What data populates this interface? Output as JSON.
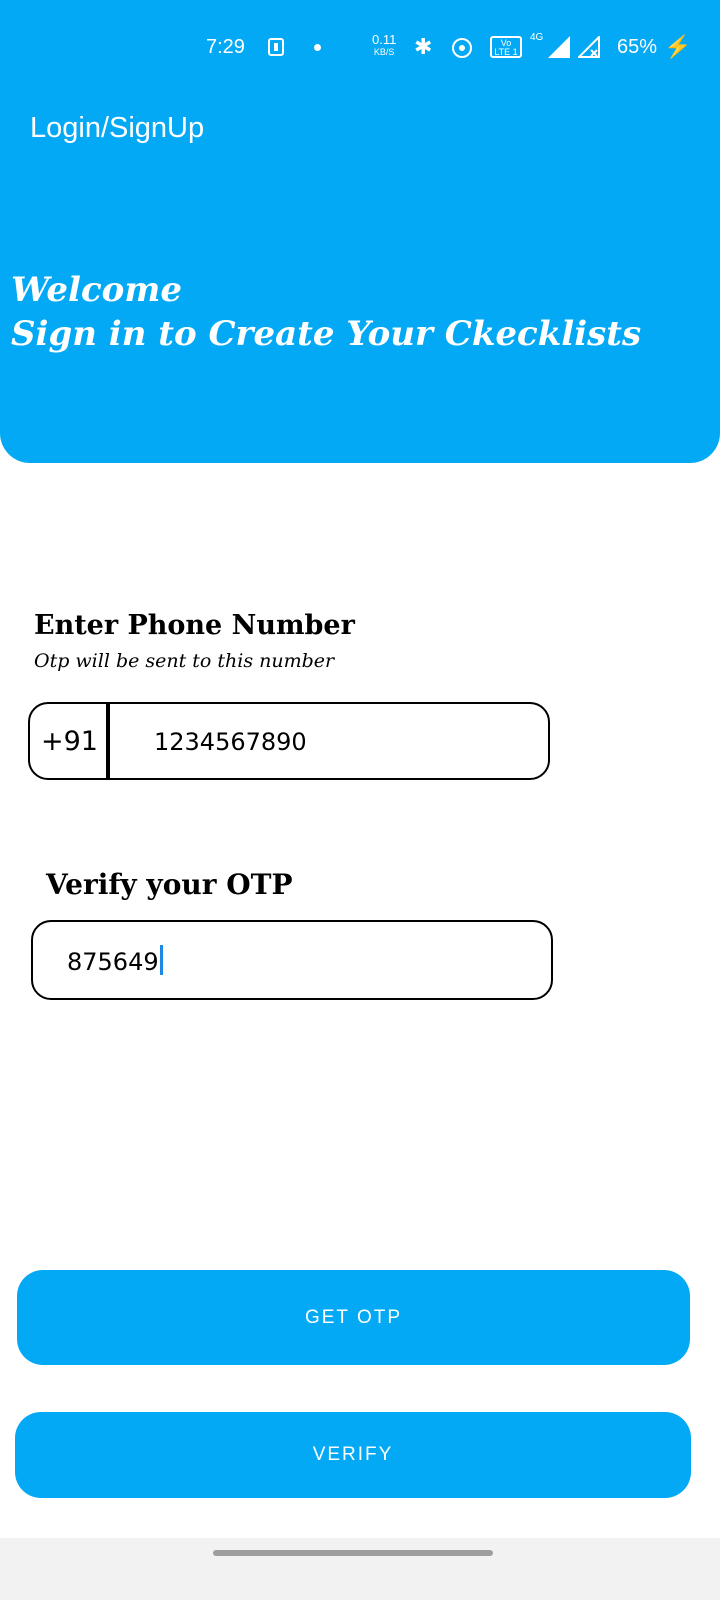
{
  "status_bar": {
    "time": "7:29",
    "speed_value": "0.11",
    "speed_unit": "KB/S",
    "volte": "Vo LTE 1",
    "net_type": "4G",
    "battery": "65%",
    "icons": [
      "download-icon",
      "dot-icon",
      "bluetooth-icon",
      "hotspot-icon",
      "volte-icon",
      "signal-icon",
      "signal-x-icon",
      "charging-icon"
    ]
  },
  "header": {
    "app_title": "Login/SignUp",
    "welcome_line1": "Welcome",
    "welcome_line2": "Sign in to Create Your Ckecklists",
    "background": "#03a9f4"
  },
  "phone": {
    "label": "Enter Phone Number",
    "hint": "Otp will be sent to this number",
    "country_code": "+91",
    "value": "1234567890"
  },
  "otp": {
    "label": "Verify your OTP",
    "value": "875649"
  },
  "buttons": {
    "get_otp": "GET OTP",
    "verify": "VERIFY"
  }
}
